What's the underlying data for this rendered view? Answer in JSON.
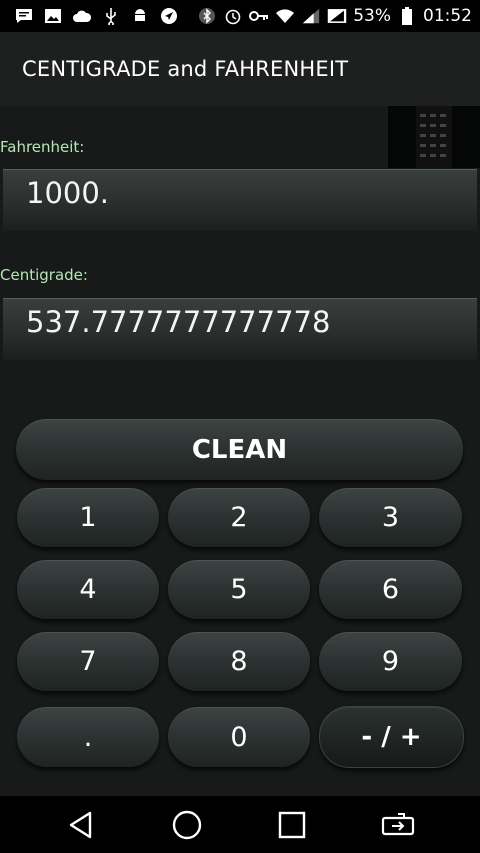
{
  "status_bar": {
    "battery_percent": "53%",
    "time": "01:52"
  },
  "app": {
    "title": "CENTIGRADE and FAHRENHEIT"
  },
  "fahrenheit": {
    "label": "Fahrenheit:",
    "value": "1000."
  },
  "centigrade": {
    "label": "Centigrade:",
    "value": "537.7777777777778"
  },
  "keypad": {
    "clean": "CLEAN",
    "k1": "1",
    "k2": "2",
    "k3": "3",
    "k4": "4",
    "k5": "5",
    "k6": "6",
    "k7": "7",
    "k8": "8",
    "k9": "9",
    "kdot": ".",
    "k0": "0",
    "ksign": "- / +"
  },
  "colors": {
    "label_green": "#b7e5b5",
    "background": "#171a19"
  },
  "icons": {
    "nav": [
      "back-icon",
      "home-icon",
      "recents-icon",
      "screen-rotate-icon"
    ]
  }
}
